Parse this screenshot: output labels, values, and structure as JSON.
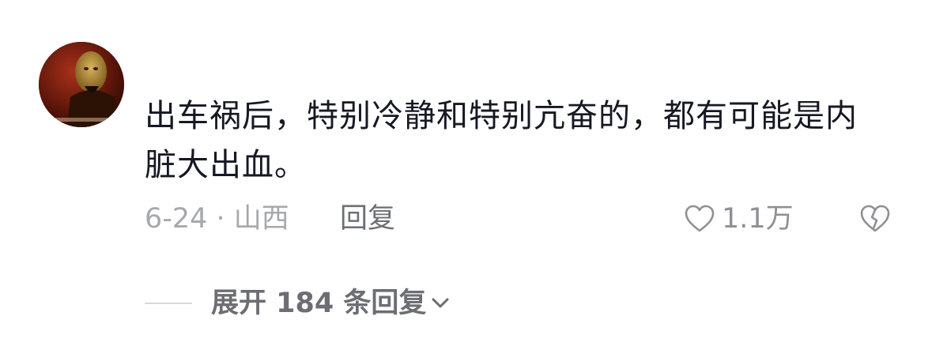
{
  "comment": {
    "text": "出车祸后，特别冷静和特别亢奋的，都有可能是内脏大出血。",
    "date_location": "6-24 · 山西",
    "reply_label": "回复",
    "like_count": "1.1万"
  },
  "replies": {
    "expand_label": "展开 184 条回复"
  },
  "icons": {
    "avatar": "avatar-image",
    "like": "heart-outline-icon",
    "dislike": "broken-heart-icon",
    "expand": "chevron-down-icon"
  },
  "colors": {
    "text_primary": "#161823",
    "text_secondary": "#a7a8ad",
    "action": "#6c6e74",
    "icon": "#8f9096"
  }
}
